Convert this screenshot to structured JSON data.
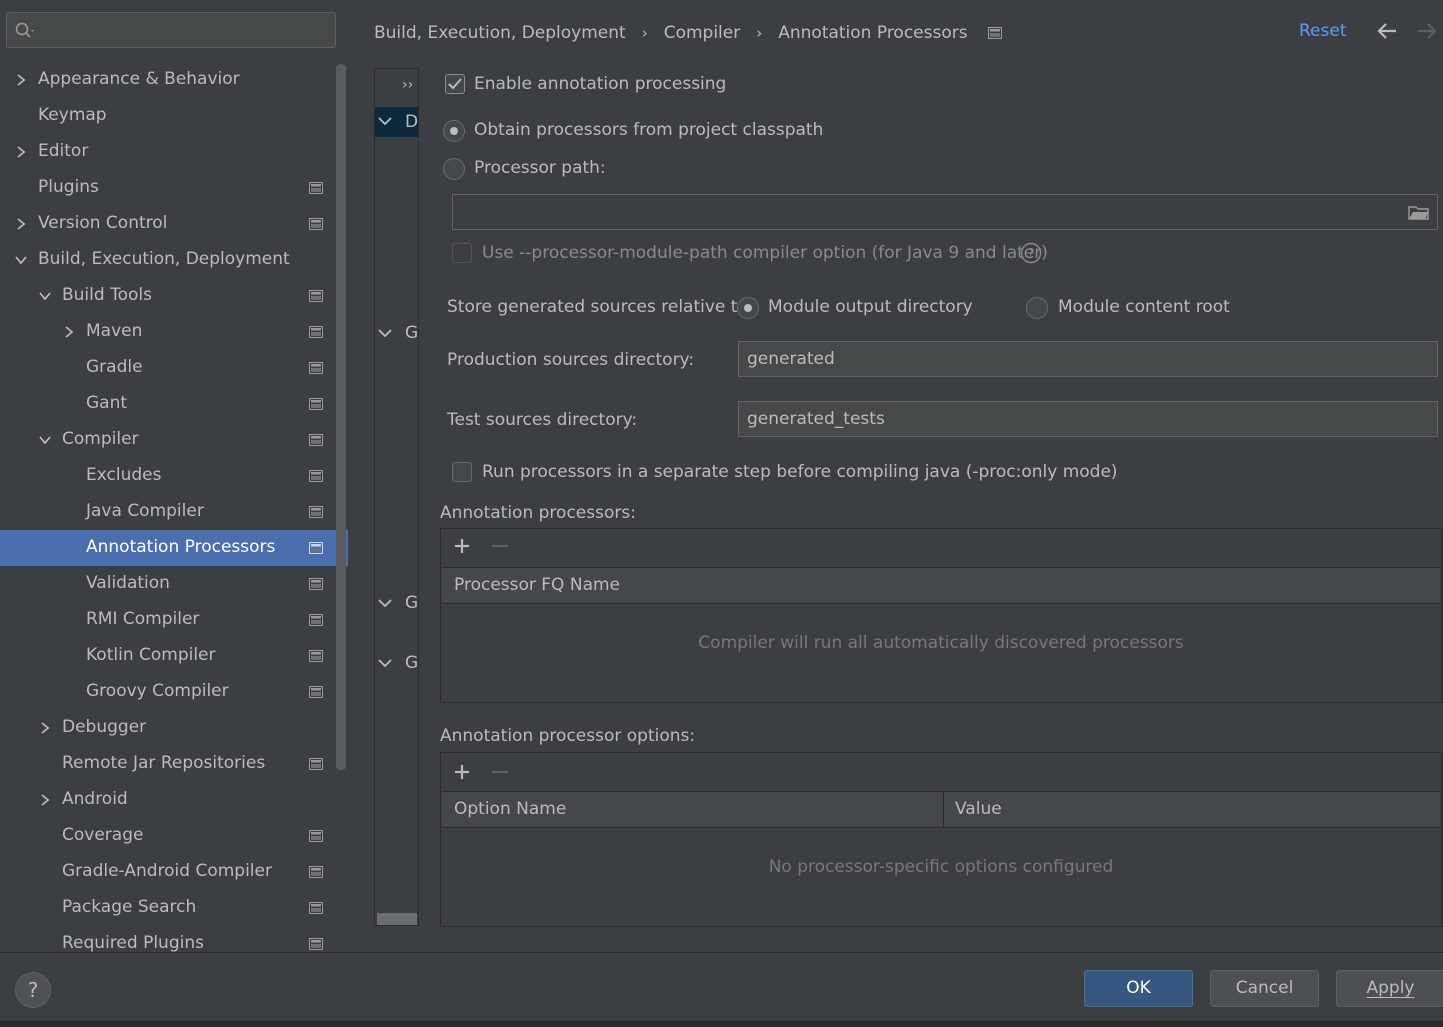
{
  "search": {
    "placeholder": "",
    "value": ""
  },
  "sidebar": {
    "items": [
      {
        "label": "Appearance & Behavior",
        "expander": "collapsed",
        "project_icon": false,
        "selected": false
      },
      {
        "label": "Keymap",
        "expander": "none",
        "project_icon": false,
        "selected": false
      },
      {
        "label": "Editor",
        "expander": "collapsed",
        "project_icon": false,
        "selected": false
      },
      {
        "label": "Plugins",
        "expander": "none",
        "project_icon": true,
        "selected": false
      },
      {
        "label": "Version Control",
        "expander": "collapsed",
        "project_icon": true,
        "selected": false
      },
      {
        "label": "Build, Execution, Deployment",
        "expander": "expanded",
        "project_icon": false,
        "selected": false
      },
      {
        "label": "Build Tools",
        "expander": "expanded",
        "project_icon": true,
        "selected": false
      },
      {
        "label": "Maven",
        "expander": "collapsed",
        "project_icon": true,
        "selected": false
      },
      {
        "label": "Gradle",
        "expander": "none",
        "project_icon": true,
        "selected": false
      },
      {
        "label": "Gant",
        "expander": "none",
        "project_icon": true,
        "selected": false
      },
      {
        "label": "Compiler",
        "expander": "expanded",
        "project_icon": true,
        "selected": false
      },
      {
        "label": "Excludes",
        "expander": "none",
        "project_icon": true,
        "selected": false
      },
      {
        "label": "Java Compiler",
        "expander": "none",
        "project_icon": true,
        "selected": false
      },
      {
        "label": "Annotation Processors",
        "expander": "none",
        "project_icon": true,
        "selected": true
      },
      {
        "label": "Validation",
        "expander": "none",
        "project_icon": true,
        "selected": false
      },
      {
        "label": "RMI Compiler",
        "expander": "none",
        "project_icon": true,
        "selected": false
      },
      {
        "label": "Kotlin Compiler",
        "expander": "none",
        "project_icon": true,
        "selected": false
      },
      {
        "label": "Groovy Compiler",
        "expander": "none",
        "project_icon": true,
        "selected": false
      },
      {
        "label": "Debugger",
        "expander": "collapsed",
        "project_icon": false,
        "selected": false
      },
      {
        "label": "Remote Jar Repositories",
        "expander": "none",
        "project_icon": true,
        "selected": false
      },
      {
        "label": "Android",
        "expander": "collapsed",
        "project_icon": false,
        "selected": false
      },
      {
        "label": "Coverage",
        "expander": "none",
        "project_icon": true,
        "selected": false
      },
      {
        "label": "Gradle-Android Compiler",
        "expander": "none",
        "project_icon": true,
        "selected": false
      },
      {
        "label": "Package Search",
        "expander": "none",
        "project_icon": true,
        "selected": false
      },
      {
        "label": "Required Plugins",
        "expander": "none",
        "project_icon": true,
        "selected": false
      }
    ]
  },
  "header": {
    "breadcrumb": [
      "Build, Execution, Deployment",
      "Compiler",
      "Annotation Processors"
    ],
    "separator": "›",
    "reset_label": "Reset"
  },
  "strip": {
    "expand_label": "››",
    "rows": [
      {
        "glyph": "D",
        "highlighted": true
      },
      {
        "glyph": "G",
        "highlighted": false
      },
      {
        "glyph": "G",
        "highlighted": false
      },
      {
        "glyph": "G",
        "highlighted": false
      }
    ]
  },
  "form": {
    "enable_processing": {
      "label": "Enable annotation processing",
      "checked": true
    },
    "obtain_from_classpath": {
      "label": "Obtain processors from project classpath",
      "selected": true
    },
    "processor_path": {
      "label": "Processor path:",
      "selected": false,
      "value": ""
    },
    "module_path_option": {
      "label": "Use --processor-module-path compiler option (for Java 9 and later)",
      "checked": false,
      "enabled": false
    },
    "store_relative": {
      "label": "Store generated sources relative to:",
      "options": [
        {
          "label": "Module output directory",
          "selected": true
        },
        {
          "label": "Module content root",
          "selected": false
        }
      ]
    },
    "production_dir": {
      "label": "Production sources directory:",
      "value": "generated"
    },
    "test_dir": {
      "label": "Test sources directory:",
      "value": "generated_tests"
    },
    "separate_step": {
      "label": "Run processors in a separate step before compiling java (-proc:only mode)",
      "checked": false
    }
  },
  "processors_panel": {
    "title": "Annotation processors:",
    "add": "+",
    "remove": "−",
    "columns": [
      "Processor FQ Name"
    ],
    "rows": [],
    "empty_text": "Compiler will run all automatically discovered processors"
  },
  "options_panel": {
    "title": "Annotation processor options:",
    "add": "+",
    "remove": "−",
    "columns": [
      "Option Name",
      "Value"
    ],
    "rows": [],
    "empty_text": "No processor-specific options configured"
  },
  "footer": {
    "help": "?",
    "ok": "OK",
    "cancel": "Cancel",
    "apply": "Apply"
  },
  "colors": {
    "background": "#3c3f41",
    "selection": "#4b6eaf",
    "link": "#589df6",
    "primary_button": "#365880",
    "text": "#bbbbbb"
  }
}
